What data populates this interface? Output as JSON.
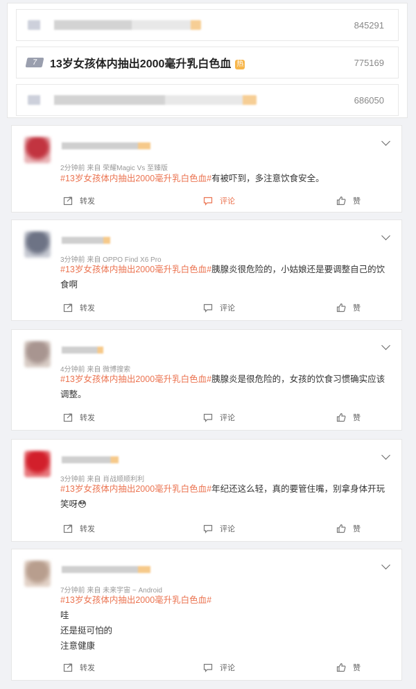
{
  "hot_list": [
    {
      "count": "845291"
    },
    {
      "rank": "7",
      "title": "13岁女孩体内抽出2000毫升乳白色血",
      "hot_badge": "热",
      "count": "775169"
    },
    {
      "count": "686050"
    }
  ],
  "actions": {
    "repost": "转发",
    "comment": "评论",
    "like": "赞"
  },
  "comments": [
    {
      "meta": "2分钟前  来自 荣耀Magic Vs 至臻版",
      "tag": "#13岁女孩体内抽出2000毫升乳白色血#",
      "text": "有被吓到，多注意饮食安全。",
      "avatar_colors": [
        "#c23440",
        "#e9b3b6"
      ]
    },
    {
      "meta": "3分钟前  来自 OPPO Find X6 Pro",
      "tag": "#13岁女孩体内抽出2000毫升乳白色血#",
      "text": "胰腺炎很危险的，小姑娘还是要调整自己的饮食啊",
      "avatar_colors": [
        "#6d7385",
        "#c7cad3"
      ]
    },
    {
      "meta": "4分钟前  来自 微博搜索",
      "tag": "#13岁女孩体内抽出2000毫升乳白色血#",
      "text": "胰腺炎是很危险的，女孩的饮食习惯确实应该调整。",
      "avatar_colors": [
        "#a89590",
        "#d9cdc6"
      ]
    },
    {
      "meta": "3分钟前  来自 肖战顺顺利利",
      "tag": "#13岁女孩体内抽出2000毫升乳白色血#",
      "text": "年纪还这么轻，真的要管住嘴，别拿身体开玩笑呀😳",
      "avatar_colors": [
        "#d21f2b",
        "#e87a7e"
      ]
    },
    {
      "meta": "7分钟前  来自 未来宇宙 ~ Android",
      "tag": "#13岁女孩体内抽出2000毫升乳白色血#",
      "lines": [
        "哇",
        "还是挺可怕的",
        "注意健康"
      ],
      "avatar_colors": [
        "#b89e8e",
        "#e3d3c8"
      ]
    }
  ]
}
